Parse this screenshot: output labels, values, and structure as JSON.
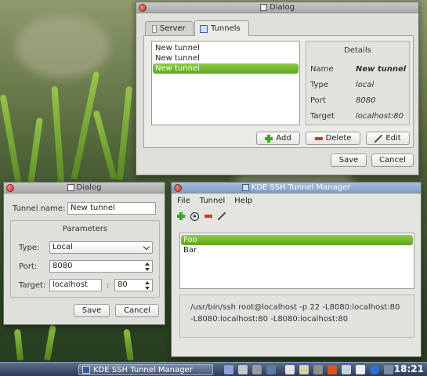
{
  "colors": {
    "selection_green": "#6bb52e",
    "title_active": "#8ea9cf",
    "window_bg": "#dfdfdb"
  },
  "main_dialog": {
    "title": "Dialog",
    "tabs": [
      {
        "label": "Server",
        "icon": "server-icon"
      },
      {
        "label": "Tunnels",
        "icon": "tunnels-icon"
      }
    ],
    "tunnels": [
      "New tunnel",
      "New tunnel",
      "New tunnel"
    ],
    "details": {
      "title": "Details",
      "rows": [
        {
          "label": "Name",
          "value": "New tunnel"
        },
        {
          "label": "Type",
          "value": "local"
        },
        {
          "label": "Port",
          "value": "8080"
        },
        {
          "label": "Target",
          "value": "localhost:80"
        }
      ]
    },
    "buttons": {
      "add": "Add",
      "delete": "Delete",
      "edit": "Edit",
      "save": "Save",
      "cancel": "Cancel"
    }
  },
  "edit_dialog": {
    "title": "Dialog",
    "tunnel_name_label": "Tunnel name:",
    "tunnel_name_value": "New tunnel",
    "parameters_title": "Parameters",
    "type_label": "Type:",
    "type_value": "Local",
    "port_label": "Port:",
    "port_value": "8080",
    "target_label": "Target:",
    "target_host": "localhost",
    "target_sep": ":",
    "target_port": "80",
    "buttons": {
      "save": "Save",
      "cancel": "Cancel"
    }
  },
  "manager": {
    "title": "KDE SSH Tunnel Manager",
    "menu": [
      "File",
      "Tunnel",
      "Help"
    ],
    "toolbar_icons": [
      "add-icon",
      "play-icon",
      "remove-icon",
      "edit-icon"
    ],
    "servers": [
      "Foo",
      "Bar"
    ],
    "command": "/usr/bin/ssh root@localhost -p 22 -L8080:localhost:80 -L8080:localhost:80 -L8080:localhost:80"
  },
  "taskbar": {
    "task_label": "KDE SSH Tunnel Manager",
    "clock": "18:21"
  }
}
